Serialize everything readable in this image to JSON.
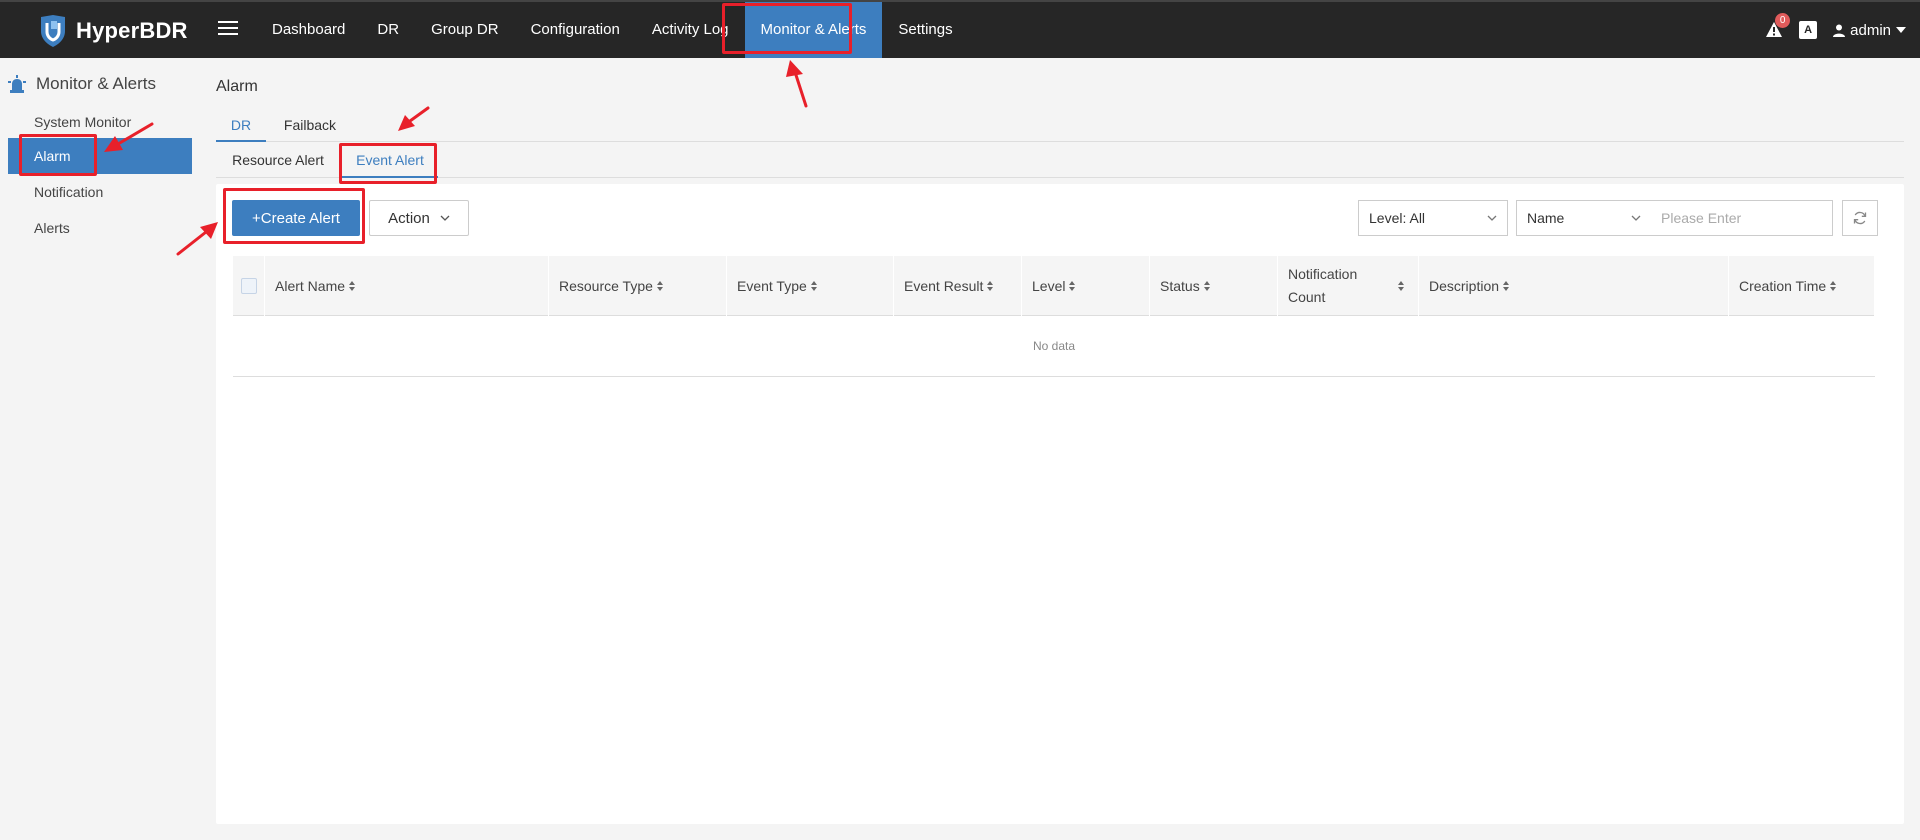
{
  "app": {
    "name": "HyperBDR"
  },
  "nav": {
    "items": [
      {
        "label": "Dashboard"
      },
      {
        "label": "DR"
      },
      {
        "label": "Group DR"
      },
      {
        "label": "Configuration"
      },
      {
        "label": "Activity Log"
      },
      {
        "label": "Monitor & Alerts",
        "active": true
      },
      {
        "label": "Settings"
      }
    ]
  },
  "header": {
    "alert_count": "0",
    "lang_icon": "A",
    "user": "admin"
  },
  "sidebar": {
    "title": "Monitor & Alerts",
    "items": [
      {
        "label": "System Monitor"
      },
      {
        "label": "Alarm",
        "active": true
      },
      {
        "label": "Notification"
      },
      {
        "label": "Alerts"
      }
    ]
  },
  "page": {
    "title": "Alarm",
    "tabs": [
      {
        "label": "DR",
        "active": true
      },
      {
        "label": "Failback"
      }
    ],
    "subtabs": [
      {
        "label": "Resource Alert"
      },
      {
        "label": "Event Alert",
        "active": true
      }
    ]
  },
  "toolbar": {
    "create_label": "+Create Alert",
    "action_label": "Action",
    "level_select": "Level: All",
    "field_select": "Name",
    "search_placeholder": "Please Enter"
  },
  "table": {
    "columns": [
      "Alert Name",
      "Resource Type",
      "Event Type",
      "Event Result",
      "Level",
      "Status",
      "Notification Count",
      "Description",
      "Creation Time"
    ],
    "empty_text": "No data"
  },
  "colors": {
    "topbar": "#262626",
    "accent": "#3d7ebf",
    "highlight": "#e8202a",
    "badge": "#e05b5b"
  }
}
